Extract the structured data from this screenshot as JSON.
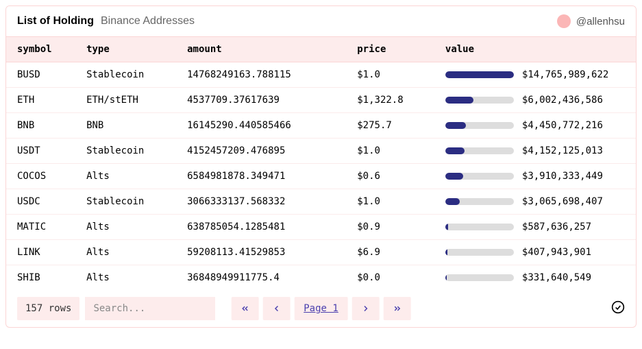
{
  "header": {
    "title": "List of Holding",
    "subtitle": "Binance Addresses",
    "username": "@allenhsu"
  },
  "columns": {
    "symbol": "symbol",
    "type": "type",
    "amount": "amount",
    "price": "price",
    "value": "value"
  },
  "rows": [
    {
      "symbol": "BUSD",
      "type": "Stablecoin",
      "amount": "14768249163.788115",
      "price": "$1.0",
      "value": "$14,765,989,622",
      "bar_pct": 100
    },
    {
      "symbol": "ETH",
      "type": "ETH/stETH",
      "amount": "4537709.37617639",
      "price": "$1,322.8",
      "value": "$6,002,436,586",
      "bar_pct": 41
    },
    {
      "symbol": "BNB",
      "type": "BNB",
      "amount": "16145290.440585466",
      "price": "$275.7",
      "value": "$4,450,772,216",
      "bar_pct": 30
    },
    {
      "symbol": "USDT",
      "type": "Stablecoin",
      "amount": "4152457209.476895",
      "price": "$1.0",
      "value": "$4,152,125,013",
      "bar_pct": 28
    },
    {
      "symbol": "COCOS",
      "type": "Alts",
      "amount": "6584981878.349471",
      "price": "$0.6",
      "value": "$3,910,333,449",
      "bar_pct": 26
    },
    {
      "symbol": "USDC",
      "type": "Stablecoin",
      "amount": "3066333137.568332",
      "price": "$1.0",
      "value": "$3,065,698,407",
      "bar_pct": 21
    },
    {
      "symbol": "MATIC",
      "type": "Alts",
      "amount": "638785054.1285481",
      "price": "$0.9",
      "value": "$587,636,257",
      "bar_pct": 4
    },
    {
      "symbol": "LINK",
      "type": "Alts",
      "amount": "59208113.41529853",
      "price": "$6.9",
      "value": "$407,943,901",
      "bar_pct": 3
    },
    {
      "symbol": "SHIB",
      "type": "Alts",
      "amount": "36848949911775.4",
      "price": "$0.0",
      "value": "$331,640,549",
      "bar_pct": 2
    }
  ],
  "footer": {
    "rows_label": "157 rows",
    "search_placeholder": "Search...",
    "page_label": "Page 1"
  }
}
